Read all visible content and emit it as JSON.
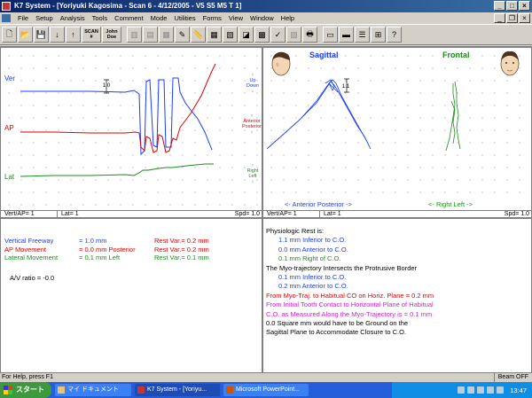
{
  "window": {
    "title": "K7 System - [Yoriyuki Kagosima - Scan 6 - 4/12/2005 - V5 S5     M5   T 1]"
  },
  "menu": [
    "File",
    "Setup",
    "Analysis",
    "Tools",
    "Comment",
    "Mode",
    "Utilities",
    "Forms",
    "View",
    "Window",
    "Help"
  ],
  "toolbar": {
    "scan_label": "SCAN\n#",
    "john_doe_label": "John\nDoe"
  },
  "left_panel": {
    "trace_labels": {
      "ver": "Ver",
      "ap": "AP",
      "lat": "Lat"
    },
    "scale_label": "1.0",
    "direction_labels": {
      "up": "Up",
      "down": "Down",
      "anterior": "Anterior",
      "posterior": "Posterior",
      "right": "Right",
      "left": "Left"
    },
    "status": {
      "vert_ap": "Vert/AP= 1",
      "lat": "Lat= 1",
      "spd": "Spd= 1.0"
    }
  },
  "right_panel": {
    "sagittal_title": "Sagittal",
    "frontal_title": "Frontal",
    "scale_label": "1.1",
    "sagittal_axis": "<- Anterior  Posterior ->",
    "frontal_axis": "<- Right  Left ->",
    "status": {
      "vert_ap": "Vert/AP= 1",
      "lat": "Lat= 1",
      "spd": "Spd= 1.0"
    }
  },
  "measurements": [
    {
      "label": "Vertical Freeway",
      "value": "= 1.0 mm",
      "rest": "Rest Var.= 0.2 mm",
      "color": "#1a3cff"
    },
    {
      "label": "AP Movement",
      "value": "= 0.0 mm Posterior",
      "rest": "Rest Var.= 0.2 mm",
      "color": "#e00000"
    },
    {
      "label": "Lateral Movement",
      "value": "= 0.1 mm Left",
      "rest": "Rest Var.= 0.1 mm",
      "color": "#1f8a1f"
    }
  ],
  "av_ratio": "A/V ratio = -0.0",
  "report": [
    {
      "text": "Physiologic Rest is:",
      "color": "#000000",
      "indent": 0
    },
    {
      "text": "1.1 mm Inferior to C.O.",
      "color": "#1a3cff",
      "indent": 1
    },
    {
      "text": "0.0 mm Anterior to C.O.",
      "color": "#1a3cff",
      "indent": 1
    },
    {
      "text": "0.1 mm Right of C.O.",
      "color": "#1f8a1f",
      "indent": 1
    },
    {
      "text": "The Myo-trajectory Intersects the Protrusive Border",
      "color": "#000000",
      "indent": 0
    },
    {
      "text": "0.1 mm Inferior to C.O.",
      "color": "#1a3cff",
      "indent": 1
    },
    {
      "text": "0.2 mm Anterior to C.O.",
      "color": "#1a3cff",
      "indent": 1
    },
    {
      "text": "From Myo-Traj. to Habitual CO on Horiz. Plane =  0.2 mm",
      "color": "#e00000",
      "indent": 0
    },
    {
      "text": "From Initial Tooth Contact to Horizontal Plane of Habitual",
      "color": "#d21ed2",
      "indent": 0
    },
    {
      "text": "C.O. as Measured Along the Myo-Trajectory is = 0.1 mm",
      "color": "#d21ed2",
      "indent": 0
    },
    {
      "text": "0.0  Square mm would have to be Ground on the",
      "color": "#000000",
      "indent": 0
    },
    {
      "text": "Sagittal Plane to  Accommodate Closure to C.O.",
      "color": "#000000",
      "indent": 0
    }
  ],
  "statusbar": {
    "help": "For Help, press F1",
    "beam": "Beam OFF"
  },
  "taskbar": {
    "start": "スタート",
    "tasks": [
      "マイ ドキュメント",
      "K7 System - [Yoriyu...",
      "Microsoft PowerPoint..."
    ],
    "clock": "13:47"
  }
}
